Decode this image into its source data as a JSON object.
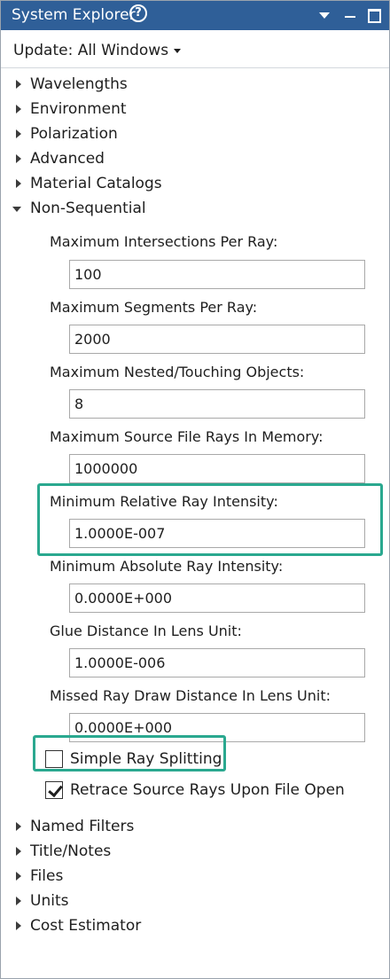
{
  "window": {
    "title": "System Explorer",
    "help_glyph": "?",
    "controls": [
      "dropdown-icon",
      "minimize-icon",
      "maximize-icon"
    ],
    "title_bar_color": "#2f5f98"
  },
  "update": {
    "label": "Update: All Windows"
  },
  "tree_top": [
    {
      "label": "Wavelengths"
    },
    {
      "label": "Environment"
    },
    {
      "label": "Polarization"
    },
    {
      "label": "Advanced"
    },
    {
      "label": "Material Catalogs"
    },
    {
      "label": "Non-Sequential"
    }
  ],
  "non_sequential": {
    "fields": [
      {
        "label": "Maximum Intersections Per Ray:",
        "value": "100"
      },
      {
        "label": "Maximum Segments Per Ray:",
        "value": "2000"
      },
      {
        "label": "Maximum Nested/Touching Objects:",
        "value": "8"
      },
      {
        "label": "Maximum Source File Rays In Memory:",
        "value": "1000000"
      },
      {
        "label": "Minimum Relative Ray Intensity:",
        "value": "1.0000E-007"
      },
      {
        "label": "Minimum Absolute Ray Intensity:",
        "value": "0.0000E+000"
      },
      {
        "label": "Glue Distance In Lens Unit:",
        "value": "1.0000E-006"
      },
      {
        "label": "Missed Ray Draw Distance In Lens Unit:",
        "value": "0.0000E+000"
      }
    ],
    "checkboxes": [
      {
        "label": "Simple Ray Splitting",
        "checked": false
      },
      {
        "label": "Retrace Source Rays Upon File Open",
        "checked": true
      }
    ]
  },
  "tree_bottom": [
    {
      "label": "Named Filters"
    },
    {
      "label": "Title/Notes"
    },
    {
      "label": "Files"
    },
    {
      "label": "Units"
    },
    {
      "label": "Cost Estimator"
    }
  ],
  "highlight_color": "#2aa88f"
}
